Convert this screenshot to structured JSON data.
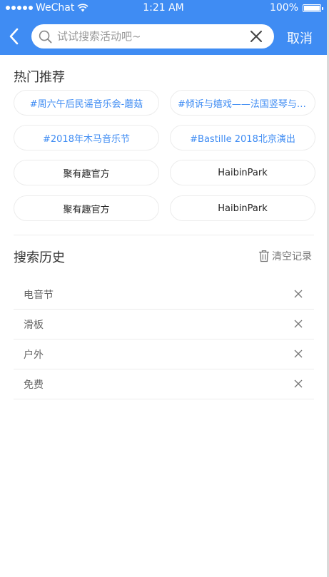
{
  "status_bar": {
    "carrier": "WeChat",
    "time": "1:21 AM",
    "battery": "100%",
    "signal_icon": "signal-dots-icon",
    "wifi_icon": "wifi-icon",
    "battery_icon": "battery-icon"
  },
  "header": {
    "back_icon": "chevron-left-icon",
    "search": {
      "placeholder": "试试搜索活动吧~",
      "value": "",
      "icon": "search-icon",
      "clear_icon": "close-icon"
    },
    "cancel_label": "取消"
  },
  "hot": {
    "title": "热门推荐",
    "tags": [
      {
        "label": "#周六午后民谣音乐会-蘑菇",
        "style": "blue"
      },
      {
        "label": "#倾诉与嬉戏——法国竖琴与长笛",
        "style": "blue"
      },
      {
        "label": "#2018年木马音乐节",
        "style": "blue"
      },
      {
        "label": "#Bastille 2018北京演出",
        "style": "blue"
      },
      {
        "label": "聚有趣官方",
        "style": "dark"
      },
      {
        "label": "HaibinPark",
        "style": "dark"
      },
      {
        "label": "聚有趣官方",
        "style": "dark"
      },
      {
        "label": "HaibinPark",
        "style": "dark"
      }
    ]
  },
  "history": {
    "title": "搜索历史",
    "clear_label": "清空记录",
    "clear_icon": "trash-icon",
    "delete_icon": "close-icon",
    "items": [
      {
        "label": "电音节"
      },
      {
        "label": "滑板"
      },
      {
        "label": "户外"
      },
      {
        "label": "免费"
      }
    ]
  },
  "colors": {
    "accent": "#3f8cf3",
    "tag_text_blue": "#3f8cf3",
    "tag_text_dark": "#222222",
    "divider": "#ececec"
  }
}
